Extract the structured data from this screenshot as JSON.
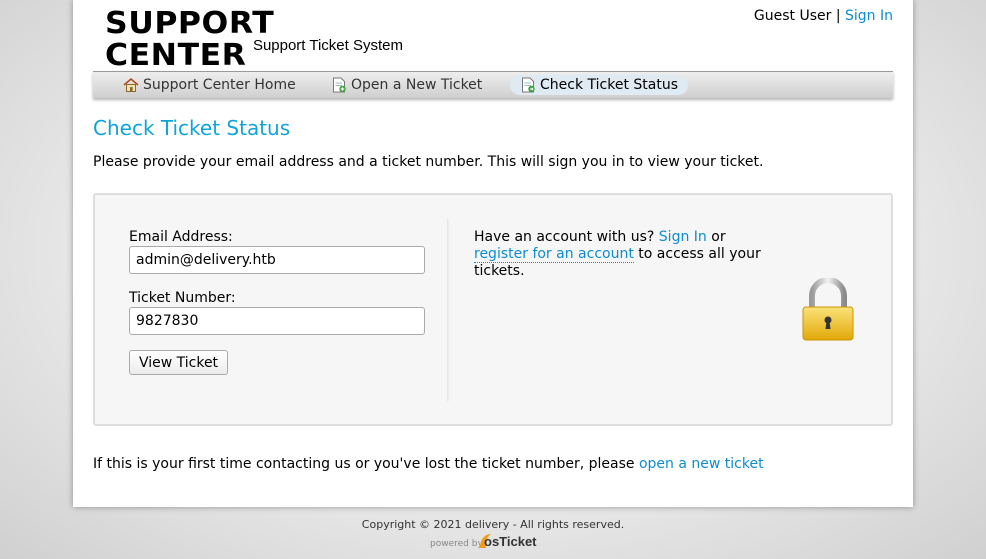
{
  "header": {
    "logo_title": "SUPPORT CENTER",
    "logo_subtitle": "Support Ticket System",
    "guest_label": "Guest User |",
    "sign_in_link": "Sign In"
  },
  "nav": {
    "items": [
      {
        "label": "Support Center Home",
        "icon": "home-icon"
      },
      {
        "label": "Open a New Ticket",
        "icon": "new-ticket-icon"
      },
      {
        "label": "Check Ticket Status",
        "icon": "ticket-status-icon",
        "active": true
      }
    ]
  },
  "page": {
    "title": "Check Ticket Status",
    "intro": "Please provide your email address and a ticket number. This will sign you in to view your ticket."
  },
  "form": {
    "email_label": "Email Address:",
    "email_value": "admin@delivery.htb",
    "ticket_label": "Ticket Number:",
    "ticket_value": "9827830",
    "view_button": "View Ticket"
  },
  "account": {
    "prefix": "Have an account with us?",
    "sign_in": "Sign In",
    "or": "or",
    "register": "register for an account",
    "suffix": "to access all your tickets."
  },
  "footer": {
    "first_time_text": "If this is your first time contacting us or you've lost the ticket number, please",
    "open_ticket_link": "open a new ticket",
    "copyright": "Copyright © 2021 delivery - All rights reserved.",
    "powered_by": "powered by",
    "brand": "osTicket"
  },
  "colors": {
    "link": "#0d8ccf",
    "heading": "#0fa4d9",
    "lock_body": "#f0c419"
  }
}
